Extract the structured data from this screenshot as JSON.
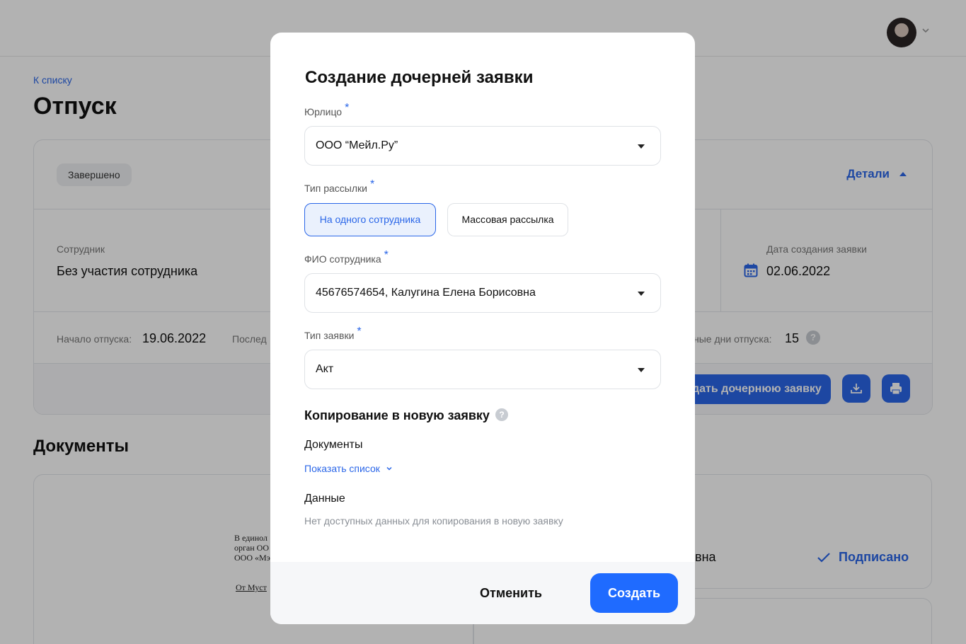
{
  "header": {
    "avatar_icon": "user-avatar",
    "chevron_icon": "chevron-down-icon"
  },
  "page": {
    "back_link": "К списку",
    "title": "Отпуск",
    "status_badge": "Завершено",
    "details_label": "Детали",
    "employee_label": "Сотрудник",
    "employee_value": "Без участия сотрудника",
    "created_label": "Дата создания заявки",
    "created_value": "02.06.2022",
    "vacation_start_label": "Начало отпуска:",
    "vacation_start_value": "19.06.2022",
    "last_label_fragment": "Послед",
    "days_label_fragment": "ные дни отпуска:",
    "days_value": "15",
    "create_child_fragment": "дать дочернюю заявку",
    "documents_title": "Документы",
    "doc_lines": [
      "В единол",
      "орган ОО",
      "ООО «Мэ",
      "От Муст"
    ],
    "doc_status_fragment": "вна",
    "signed_label": "Подписано"
  },
  "modal": {
    "title": "Создание дочерней заявки",
    "legal_entity_label": "Юрлицо",
    "legal_entity_value": "ООО “Мейл.Ру”",
    "mailing_type_label": "Тип рассылки",
    "mailing_options": [
      "На одного сотрудника",
      "Массовая рассылка"
    ],
    "mailing_selected": "На одного сотрудника",
    "employee_label": "ФИО сотрудника",
    "employee_value": "45676574654, Калугина Елена Борисовна",
    "request_type_label": "Тип заявки",
    "request_type_value": "Акт",
    "required_mark": "*",
    "copy_title": "Копирование в новую заявку",
    "help_mark": "?",
    "documents_label": "Документы",
    "show_list_link": "Показать список",
    "data_label": "Данные",
    "no_data_text": "Нет доступных данных для копирования в новую заявку",
    "cancel_button": "Отменить",
    "create_button": "Создать"
  },
  "colors": {
    "accent": "#2a66e8",
    "primary_button": "#1f6bff",
    "overlay": "rgba(0,0,0,0.30)"
  }
}
